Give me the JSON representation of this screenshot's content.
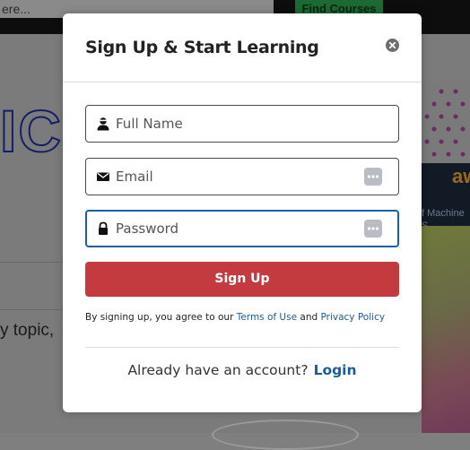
{
  "background": {
    "search_text": "ere...",
    "find_courses_label": "Find Courses",
    "hero_text": "ICH",
    "topic_text": "y topic,",
    "card_brand": "aw",
    "card_caption_1": "f Machine",
    "card_caption_2": "S"
  },
  "modal": {
    "title": "Sign Up & Start Learning",
    "fields": {
      "name_placeholder": "Full Name",
      "email_placeholder": "Email",
      "password_placeholder": "Password"
    },
    "signup_label": "Sign Up",
    "terms": {
      "prefix": "By signing up, you agree to our ",
      "terms_link": "Terms of Use",
      "and": " and ",
      "privacy_link": "Privacy Policy"
    },
    "already_text": "Already have an account?",
    "login_link": "Login"
  },
  "colors": {
    "primary_button": "#c43b3f",
    "link": "#1a5d96",
    "focus_border": "#1b5fa8"
  }
}
